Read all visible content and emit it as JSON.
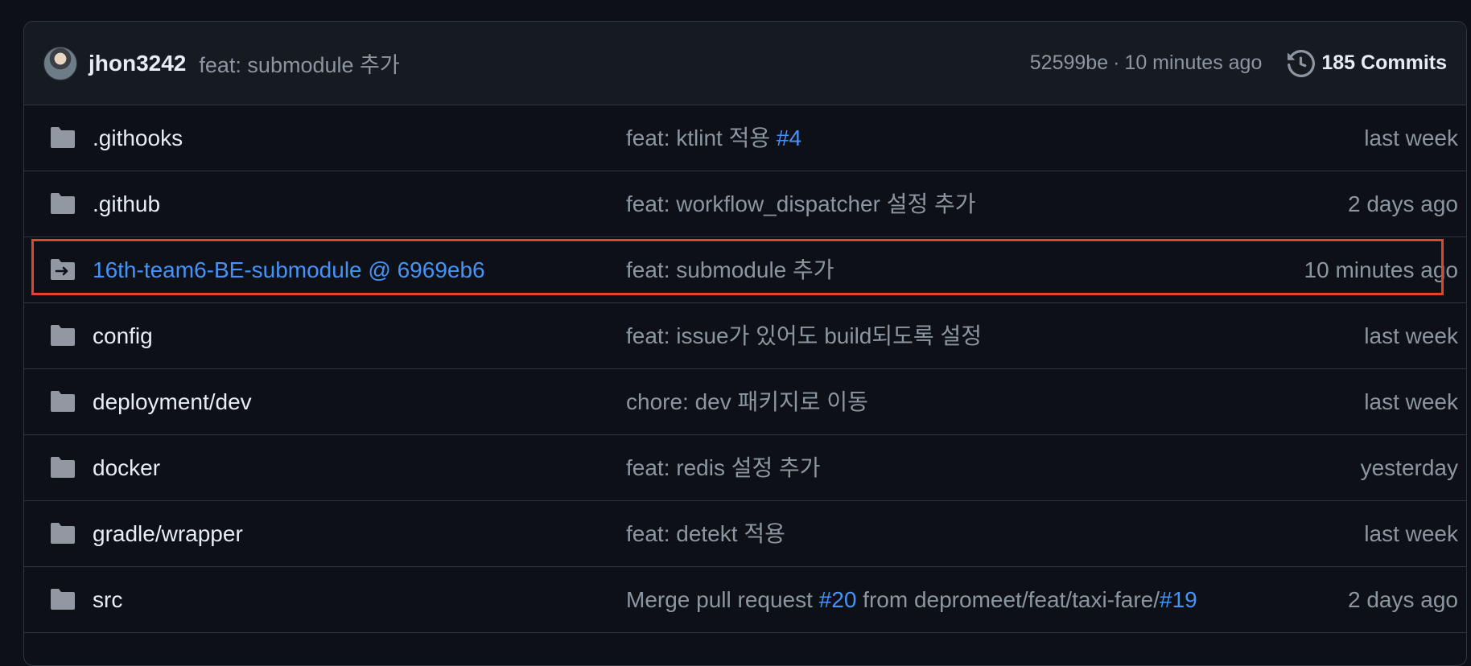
{
  "header": {
    "author": "jhon3242",
    "message": "feat: submodule 추가",
    "commit_hash": "52599be",
    "separator": "·",
    "time": "10 minutes ago",
    "commits_label": "185 Commits"
  },
  "rows": [
    {
      "name": ".githooks",
      "msg": "feat: ktlint 적용 ",
      "ref": "#4",
      "date": "last week"
    },
    {
      "name": ".github",
      "msg": "feat: workflow_dispatcher 설정 추가",
      "date": "2 days ago"
    },
    {
      "name": "16th-team6-BE-submodule @ 6969eb6",
      "msg": "feat: submodule 추가",
      "date": "10 minutes ago"
    },
    {
      "name": "config",
      "msg": "feat: issue가 있어도 build되도록 설정",
      "date": "last week"
    },
    {
      "name": "deployment/dev",
      "msg": "chore: dev 패키지로 이동",
      "date": "last week"
    },
    {
      "name": "docker",
      "msg": "feat: redis 설정 추가",
      "date": "yesterday"
    },
    {
      "name": "gradle/wrapper",
      "msg": "feat: detekt 적용",
      "date": "last week"
    },
    {
      "name": "src",
      "msg_pre": "Merge pull request ",
      "ref1": "#20",
      "msg_mid": " from depromeet/feat/taxi-fare/",
      "ref2": "#19",
      "date": "2 days ago"
    }
  ],
  "icons": {
    "folder": "folder-icon",
    "submodule": "submodule-folder-icon",
    "history": "history-icon"
  },
  "colors": {
    "link": "#4493f8",
    "highlight": "#e2452a",
    "muted": "#8d96a0"
  }
}
